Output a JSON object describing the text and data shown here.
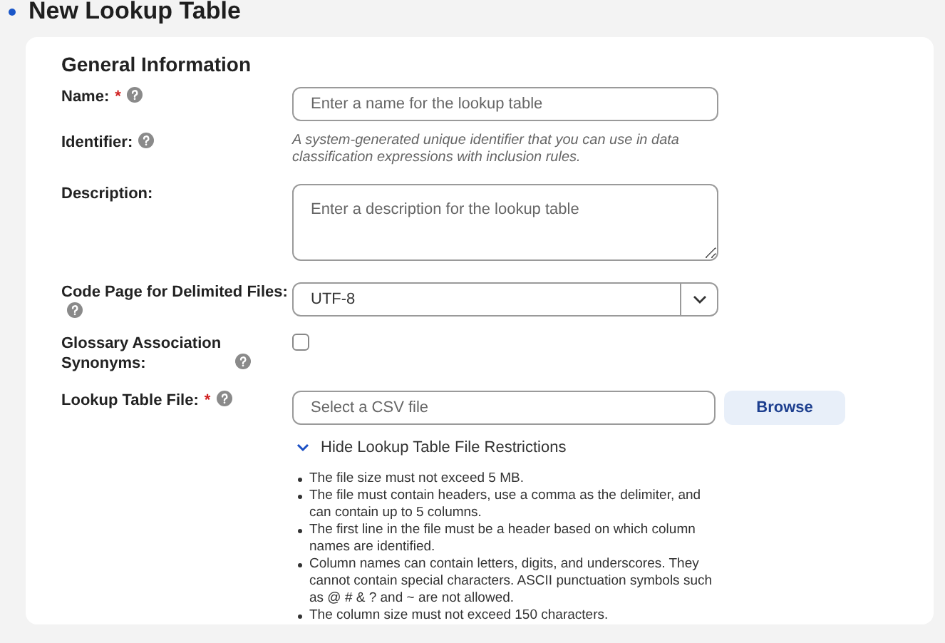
{
  "page_title": "New Lookup Table",
  "section_title": "General Information",
  "fields": [
    {
      "kind": "input",
      "label": "Name:",
      "required_mark": "*",
      "help": true,
      "placeholder": "Enter a name for the lookup table"
    },
    {
      "kind": "info",
      "label": "Identifier:",
      "help": true,
      "text": "A system-generated unique identifier that you can use in data classification expressions with inclusion rules."
    },
    {
      "kind": "textarea",
      "label": "Description:",
      "help": false,
      "placeholder": "Enter a description for the lookup table"
    },
    {
      "kind": "select",
      "label": "Code Page for Delimited Files:",
      "help": true,
      "value": "UTF-8"
    },
    {
      "kind": "checkbox",
      "label": "Glossary Association Synonyms:",
      "help": true,
      "checked": false
    },
    {
      "kind": "file",
      "label": "Lookup Table File:",
      "required_mark": "*",
      "help": true,
      "placeholder": "Select a CSV file",
      "button": "Browse"
    }
  ],
  "restrictions": {
    "toggle": "Hide Lookup Table File Restrictions",
    "expanded": true,
    "items": [
      "The file size must not exceed 5 MB.",
      "The file must contain headers, use a comma as the delimiter, and can contain up to 5 columns.",
      "The first line in the file must be a header based on which column names are identified.",
      "Column names can contain letters, digits, and underscores. They cannot contain special characters. ASCII punctuation symbols such as @ # & ? and ~ are not allowed.",
      "The column size must not exceed 150 characters."
    ]
  }
}
